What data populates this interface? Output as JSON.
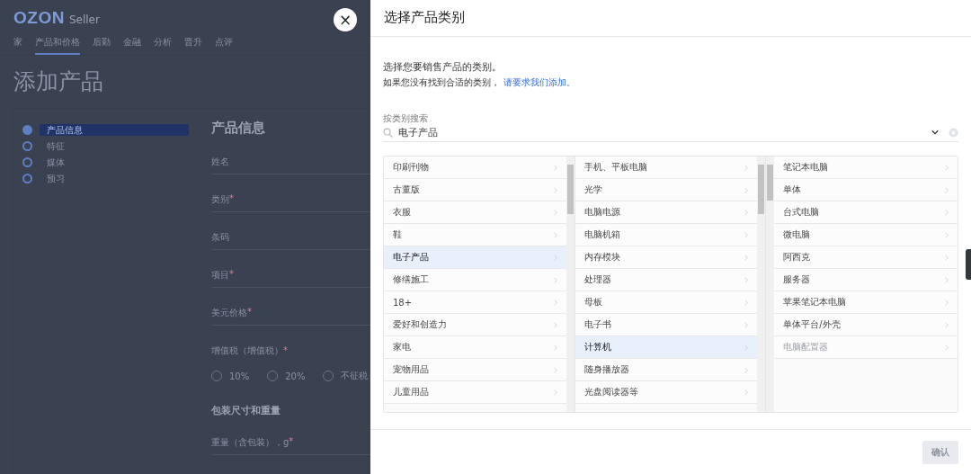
{
  "background_page": {
    "logo": {
      "brand": "OZON",
      "product": "Seller"
    },
    "nav_tabs": [
      {
        "label": "家",
        "selected": false
      },
      {
        "label": "产品和价格",
        "selected": true
      },
      {
        "label": "后勤",
        "selected": false
      },
      {
        "label": "金融",
        "selected": false
      },
      {
        "label": "分析",
        "selected": false
      },
      {
        "label": "晋升",
        "selected": false
      },
      {
        "label": "点评",
        "selected": false
      }
    ],
    "page_title": "添加产品",
    "steps": [
      {
        "label": "产品信息",
        "selected": true
      },
      {
        "label": "特征",
        "selected": false
      },
      {
        "label": "媒体",
        "selected": false
      },
      {
        "label": "预习",
        "selected": false
      }
    ],
    "form": [
      {
        "kind": "heading",
        "text": "产品信息"
      },
      {
        "kind": "field",
        "label": "姓名"
      },
      {
        "kind": "field",
        "label": "类别",
        "mark": "*"
      },
      {
        "kind": "field",
        "label": "条码"
      },
      {
        "kind": "field",
        "label": "项目",
        "mark": "*"
      },
      {
        "kind": "field",
        "label": "美元价格",
        "mark": "*"
      },
      {
        "kind": "radios",
        "label": "增值税（增值税）",
        "mark": "*",
        "options": [
          {
            "label": "10%",
            "selected": false
          },
          {
            "label": "20%",
            "selected": false
          },
          {
            "label": "不征税",
            "selected": false
          }
        ]
      },
      {
        "kind": "subheading",
        "text": "包装尺寸和重量"
      },
      {
        "kind": "field",
        "label": "重量（含包装），g",
        "mark": "*"
      }
    ]
  },
  "close_button": "×",
  "dialog": {
    "title": "选择产品类别",
    "intro": "选择您要销售产品的类别。",
    "hint": {
      "text": "如果您没有找到合适的类别，",
      "link": "请要求我们添加。"
    },
    "search": {
      "label": "按类别搜索",
      "value": "电子产品"
    },
    "columns": [
      {
        "items": [
          {
            "label": "印刷刊物",
            "selected": false,
            "disabled": false
          },
          {
            "label": "古董版",
            "selected": false,
            "disabled": false
          },
          {
            "label": "衣服",
            "selected": false,
            "disabled": false
          },
          {
            "label": "鞋",
            "selected": false,
            "disabled": false
          },
          {
            "label": "电子产品",
            "selected": true,
            "disabled": false
          },
          {
            "label": "修缮施工",
            "selected": false,
            "disabled": false
          },
          {
            "label": "18+",
            "selected": false,
            "disabled": false
          },
          {
            "label": "爱好和创造力",
            "selected": false,
            "disabled": false
          },
          {
            "label": "家电",
            "selected": false,
            "disabled": false
          },
          {
            "label": "宠物用品",
            "selected": false,
            "disabled": false
          },
          {
            "label": "儿童用品",
            "selected": false,
            "disabled": false
          }
        ]
      },
      {
        "items": [
          {
            "label": "手机、平板电脑",
            "selected": false,
            "disabled": false
          },
          {
            "label": "光学",
            "selected": false,
            "disabled": false
          },
          {
            "label": "电脑电源",
            "selected": false,
            "disabled": false
          },
          {
            "label": "电脑机箱",
            "selected": false,
            "disabled": false
          },
          {
            "label": "内存模块",
            "selected": false,
            "disabled": false
          },
          {
            "label": "处理器",
            "selected": false,
            "disabled": false
          },
          {
            "label": "母板",
            "selected": false,
            "disabled": false
          },
          {
            "label": "电子书",
            "selected": false,
            "disabled": false
          },
          {
            "label": "计算机",
            "selected": true,
            "disabled": false
          },
          {
            "label": "随身播放器",
            "selected": false,
            "disabled": false
          },
          {
            "label": "光盘阅读器等",
            "selected": false,
            "disabled": false
          }
        ]
      },
      {
        "items": [
          {
            "label": "笔记本电脑",
            "selected": false,
            "disabled": false
          },
          {
            "label": "单体",
            "selected": false,
            "disabled": false
          },
          {
            "label": "台式电脑",
            "selected": false,
            "disabled": false
          },
          {
            "label": "微电脑",
            "selected": false,
            "disabled": false
          },
          {
            "label": "阿西克",
            "selected": false,
            "disabled": false
          },
          {
            "label": "服务器",
            "selected": false,
            "disabled": false
          },
          {
            "label": "苹果笔记本电脑",
            "selected": false,
            "disabled": false
          },
          {
            "label": "单体平台/外壳",
            "selected": false,
            "disabled": false
          },
          {
            "label": "电脑配置器",
            "selected": false,
            "disabled": true
          }
        ]
      }
    ],
    "confirm_button": {
      "label": "确认",
      "disabled": true
    }
  }
}
